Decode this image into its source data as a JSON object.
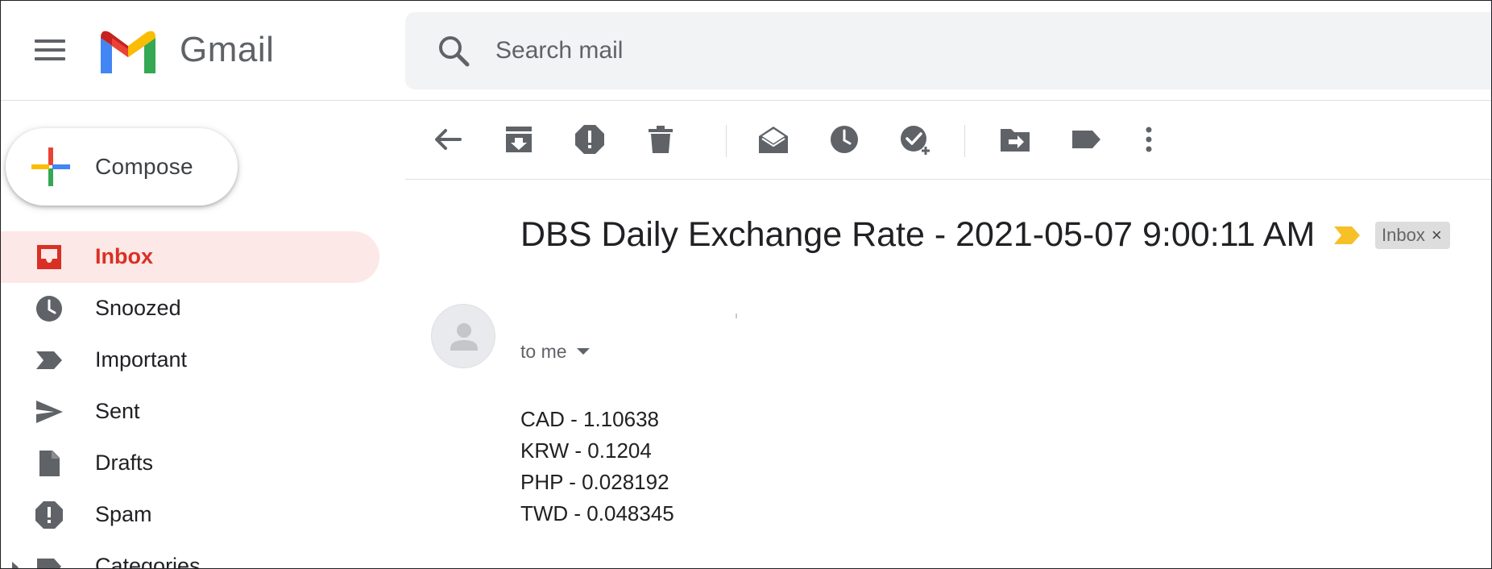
{
  "header": {
    "app_name": "Gmail",
    "search": {
      "placeholder": "Search mail",
      "value": ""
    },
    "icons": {
      "menu": "hamburger-menu-icon",
      "logo": "gmail-m-logo",
      "search": "magnifier-search-icon"
    }
  },
  "compose": {
    "label": "Compose",
    "icon": "multicolor-plus-icon"
  },
  "sidebar": {
    "items": [
      {
        "label": "Inbox",
        "icon": "inbox-icon",
        "active": true
      },
      {
        "label": "Snoozed",
        "icon": "clock-icon",
        "active": false
      },
      {
        "label": "Important",
        "icon": "important-marker-icon",
        "active": false
      },
      {
        "label": "Sent",
        "icon": "send-icon",
        "active": false
      },
      {
        "label": "Drafts",
        "icon": "draft-file-icon",
        "active": false
      },
      {
        "label": "Spam",
        "icon": "spam-report-icon",
        "active": false
      },
      {
        "label": "Categories",
        "icon": "label-icon",
        "active": false
      }
    ]
  },
  "toolbar": {
    "buttons": [
      {
        "name": "back",
        "icon": "arrow-left-icon"
      },
      {
        "name": "archive",
        "icon": "archive-icon"
      },
      {
        "name": "report-spam",
        "icon": "spam-report-icon"
      },
      {
        "name": "delete",
        "icon": "trash-icon"
      },
      {
        "name": "mark-unread",
        "icon": "mark-unread-icon"
      },
      {
        "name": "snooze",
        "icon": "clock-icon"
      },
      {
        "name": "add-to-tasks",
        "icon": "add-task-icon"
      },
      {
        "name": "move-to",
        "icon": "move-to-icon"
      },
      {
        "name": "labels",
        "icon": "label-icon"
      },
      {
        "name": "more",
        "icon": "more-vertical-icon"
      }
    ]
  },
  "message": {
    "subject": "DBS Daily Exchange Rate - 2021-05-07 9:00:11 AM",
    "label_chip": "Inbox",
    "label_remove": "×",
    "recipient": "to me",
    "body_lines": [
      "CAD - 1.10638",
      "KRW - 0.1204",
      "PHP - 0.028192",
      "TWD - 0.048345"
    ]
  },
  "colors": {
    "active_bg": "#fce8e6",
    "active_text": "#d93025",
    "important_yellow": "#f6c026",
    "icon_gray": "#5f6368",
    "search_bg": "#f1f3f4",
    "chip_bg": "#dddddd"
  }
}
